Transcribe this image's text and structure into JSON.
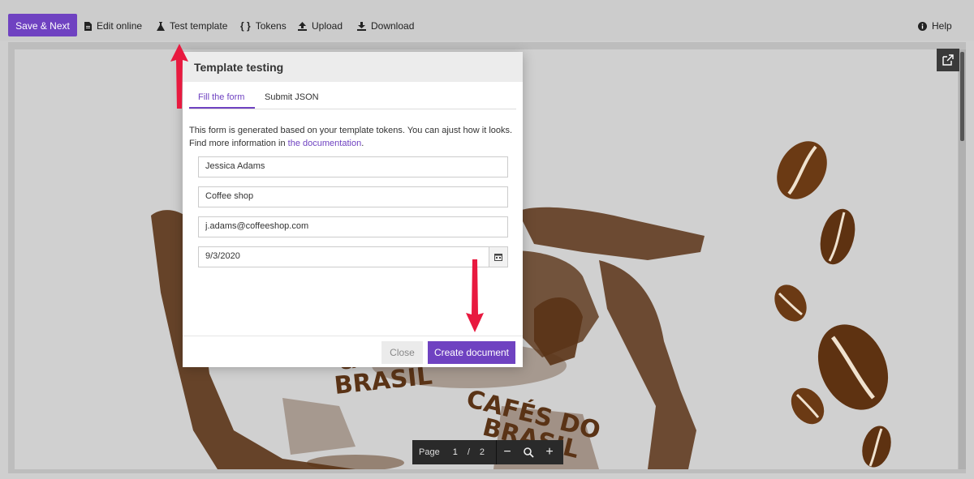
{
  "toolbar": {
    "save_next": "Save & Next",
    "edit_online": "Edit online",
    "test_template": "Test template",
    "tokens": "Tokens",
    "upload": "Upload",
    "download": "Download",
    "help": "Help"
  },
  "background_doc": {
    "text_left": "BRASIL",
    "text_right_1": "CAFÉS DO",
    "text_right_2": "BRASIL",
    "text_top_left": "CAF"
  },
  "page_controls": {
    "page_label": "Page",
    "current_page": "1",
    "separator": "/",
    "total_pages": "2"
  },
  "dialog": {
    "title": "Template testing",
    "tabs": [
      "Fill the form",
      "Submit JSON"
    ],
    "active_tab": "Fill the form",
    "intro_text": "This form is generated based on your template tokens. You can ajust how it looks. Find more information in",
    "intro_link": "the documentation",
    "intro_end": ".",
    "fields": {
      "name": "Jessica Adams",
      "company": "Coffee shop",
      "email": "j.adams@coffeeshop.com",
      "date": "9/3/2020"
    },
    "close_label": "Close",
    "create_label": "Create document"
  },
  "colors": {
    "accent": "#6f42c1",
    "annotation_arrow": "#e8193f",
    "coffee_brown": "#5a3316"
  }
}
